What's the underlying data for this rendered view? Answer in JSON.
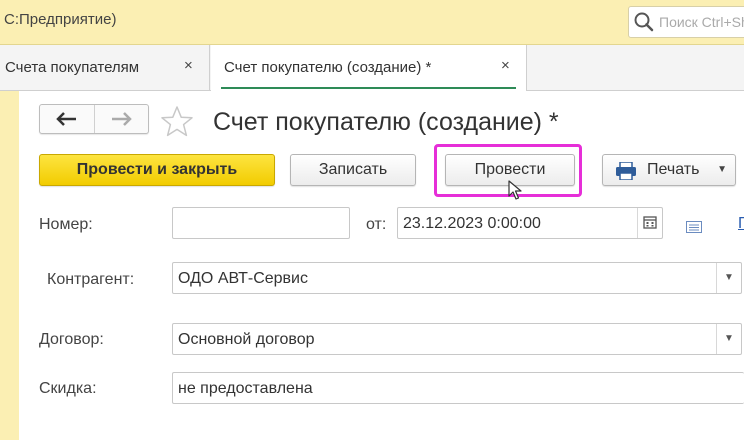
{
  "app": {
    "title": "С:Предприятие)"
  },
  "search": {
    "placeholder": "Поиск Ctrl+Shift+F"
  },
  "tabs": [
    {
      "label": "Счета покупателям",
      "close": "×"
    },
    {
      "label": "Счет покупателю (создание) *",
      "close": "×"
    }
  ],
  "form": {
    "title": "Счет покупателю (создание) *",
    "nav": {
      "back": "back-arrow-icon",
      "forward": "forward-arrow-icon"
    },
    "star_icon": "star-icon",
    "buttons": {
      "post_and_close": "Провести и закрыть",
      "save": "Записать",
      "post": "Провести",
      "print": "Печать"
    },
    "fields": {
      "number": {
        "label": "Номер:",
        "value": ""
      },
      "date": {
        "label": "от:",
        "value": "23.12.2023  0:00:00"
      },
      "counterparty": {
        "label": "Контрагент:",
        "value": "ОДО АВТ-Сервис"
      },
      "contract": {
        "label": "Договор:",
        "value": "Основной договор"
      },
      "discount": {
        "label": "Скидка:",
        "value": "не предоставлена"
      }
    },
    "link_fragment": "По"
  },
  "colors": {
    "accent_yellow": "#f7d51d",
    "titlebar_bg": "#fbefb3",
    "highlight_magenta": "#e62ed8",
    "tab_underline": "#2e8b57"
  }
}
